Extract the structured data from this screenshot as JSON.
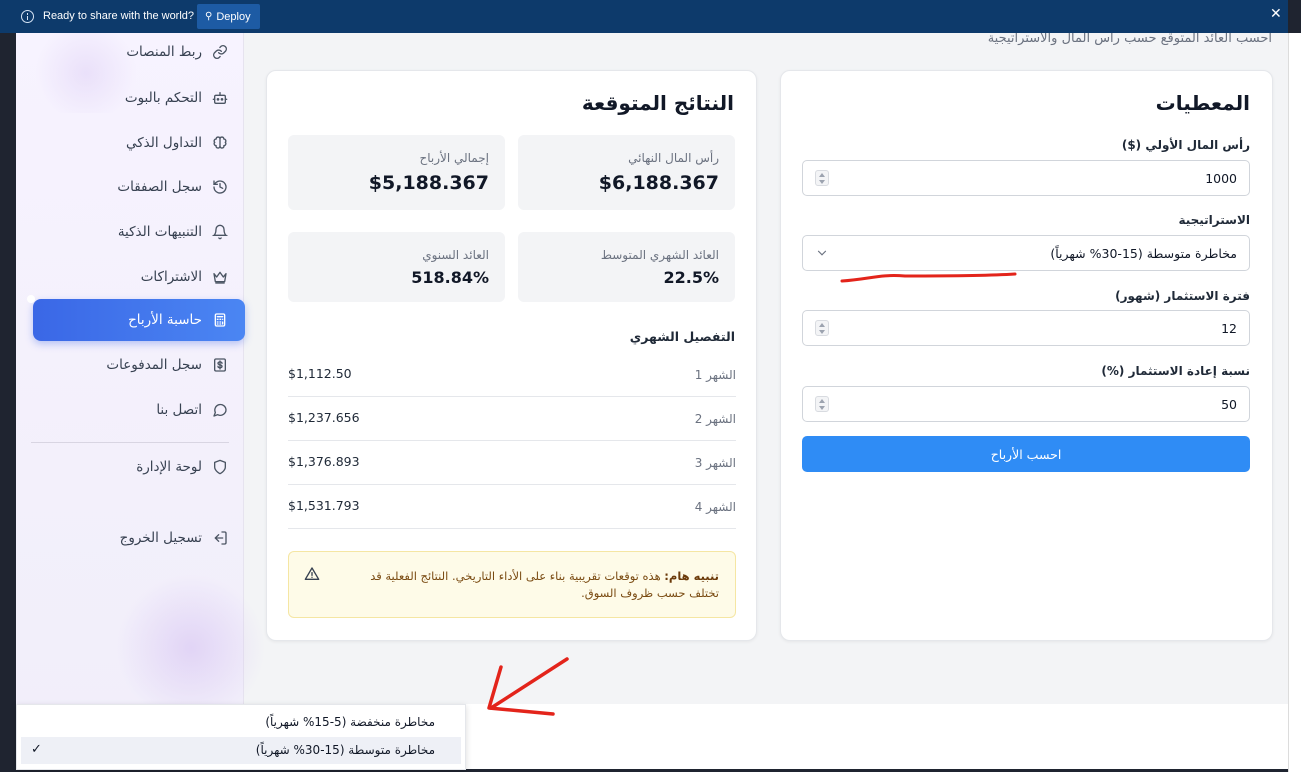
{
  "banner": {
    "message": "Ready to share with the world?",
    "deploy_label": "Deploy",
    "close_glyph": "✕"
  },
  "sidebar": {
    "items": [
      {
        "label": "ربط المنصات",
        "icon": "link-icon"
      },
      {
        "label": "التحكم بالبوت",
        "icon": "bot-icon"
      },
      {
        "label": "التداول الذكي",
        "icon": "brain-icon"
      },
      {
        "label": "سجل الصفقات",
        "icon": "history-icon"
      },
      {
        "label": "التنبيهات الذكية",
        "icon": "bell-icon"
      },
      {
        "label": "الاشتراكات",
        "icon": "crown-icon"
      },
      {
        "label": "حاسبة الأرباح",
        "icon": "calculator-icon",
        "active": true
      },
      {
        "label": "سجل المدفوعات",
        "icon": "dollar-icon"
      },
      {
        "label": "اتصل بنا",
        "icon": "chat-icon"
      }
    ],
    "admin": {
      "label": "لوحة الإدارة",
      "icon": "shield-icon"
    },
    "logout": {
      "label": "تسجيل الخروج",
      "icon": "logout-icon"
    }
  },
  "main": {
    "subtitle": "احسب العائد المتوقع حسب رأس المال والاستراتيجية",
    "params": {
      "title": "المعطيات",
      "capital_label": "رأس المال الأولي ($)",
      "capital_value": "1000",
      "strategy_label": "الاستراتيجية",
      "strategy_value": "مخاطرة متوسطة (15-30% شهرياً)",
      "period_label": "فترة الاستثمار (شهور)",
      "period_value": "12",
      "reinvest_label": "نسبة إعادة الاستثمار (%)",
      "reinvest_value": "50",
      "calc_button": "احسب الأرباح"
    },
    "results": {
      "title": "النتائج المتوقعة",
      "final_capital_label": "رأس المال النهائي",
      "final_capital_value": "$6,188.367",
      "total_profit_label": "إجمالي الأرباح",
      "total_profit_value": "$5,188.367",
      "avg_monthly_label": "العائد الشهري المتوسط",
      "avg_monthly_value": "22.5%",
      "annual_label": "العائد السنوي",
      "annual_value": "518.84%",
      "breakdown_title": "التفصيل الشهري",
      "months": [
        {
          "label": "الشهر 1",
          "value": "$1,112.50"
        },
        {
          "label": "الشهر 2",
          "value": "$1,237.656"
        },
        {
          "label": "الشهر 3",
          "value": "$1,376.893"
        },
        {
          "label": "الشهر 4",
          "value": "$1,531.793"
        }
      ],
      "alert_bold": "تنبيه هام:",
      "alert_text": " هذه توقعات تقريبية بناء على الأداء التاريخي. النتائج الفعلية قد تختلف حسب ظروف السوق."
    }
  },
  "dropdown": {
    "options": [
      {
        "label": "مخاطرة منخفضة (5-15% شهرياً)",
        "selected": false
      },
      {
        "label": "مخاطرة متوسطة (15-30% شهرياً)",
        "selected": true
      }
    ],
    "check_glyph": "✓"
  },
  "colors": {
    "accent": "#2f8cf5",
    "banner": "#0d3a6b",
    "annotation": "#e3241b"
  }
}
